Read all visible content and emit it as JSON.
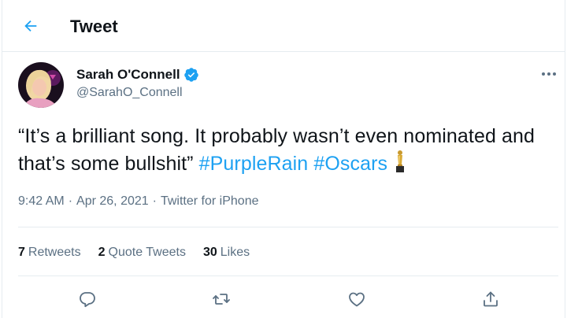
{
  "header": {
    "title": "Tweet"
  },
  "author": {
    "display_name": "Sarah O'Connell",
    "handle": "@SarahO_Connell",
    "verified": true
  },
  "tweet": {
    "text": "“It’s a brilliant song. It probably wasn’t even nominated and that’s some bullshit”",
    "hashtags": [
      "#PurpleRain",
      "#Oscars"
    ],
    "emoji_icon": "oscar-trophy-icon"
  },
  "meta": {
    "time": "9:42 AM",
    "date": "Apr 26, 2021",
    "source": "Twitter for iPhone",
    "separator": "·"
  },
  "stats": {
    "retweets": {
      "count": "7",
      "label": "Retweets"
    },
    "quotes": {
      "count": "2",
      "label": "Quote Tweets"
    },
    "likes": {
      "count": "30",
      "label": "Likes"
    }
  },
  "actions": [
    "reply-icon",
    "retweet-icon",
    "like-icon",
    "share-icon"
  ],
  "colors": {
    "accent": "#1da1f2",
    "secondary_text": "#5b7083",
    "border": "#e6ecf0"
  }
}
